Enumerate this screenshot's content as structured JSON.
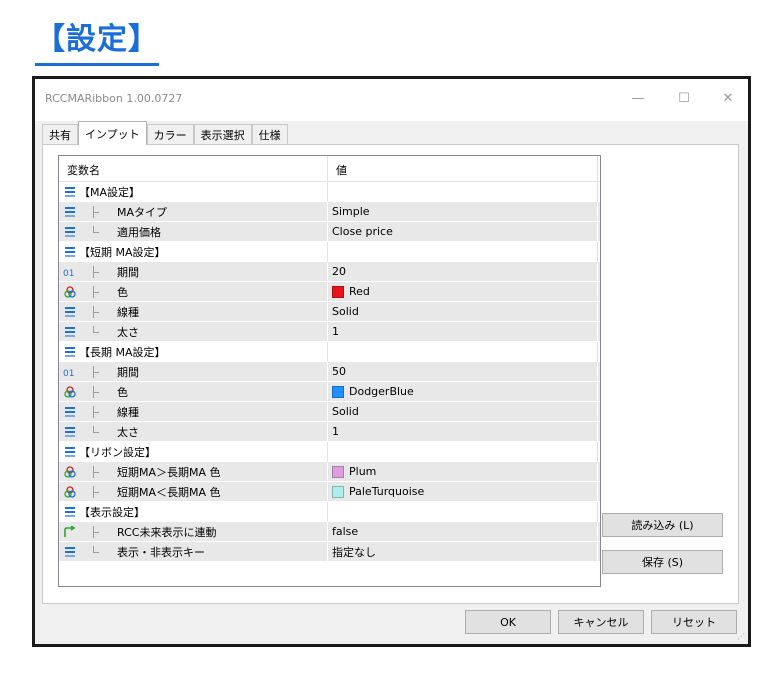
{
  "heading": "【設定】",
  "window": {
    "title": "RCCMARibbon 1.00.0727",
    "minimize_glyph": "—",
    "maximize_glyph": "☐",
    "close_glyph": "✕"
  },
  "tabs": [
    {
      "label": "共有"
    },
    {
      "label": "インプット"
    },
    {
      "label": "カラー"
    },
    {
      "label": "表示選択"
    },
    {
      "label": "仕様"
    }
  ],
  "grid": {
    "col_name": "変数名",
    "col_value": "値",
    "rows": [
      {
        "type": "group",
        "icon": "list-icon",
        "name": "【MA設定】",
        "value": ""
      },
      {
        "type": "item",
        "icon": "list-icon",
        "tree": "mid",
        "name": "MAタイプ",
        "value": "Simple"
      },
      {
        "type": "item",
        "icon": "list-icon",
        "tree": "end",
        "name": "適用価格",
        "value": "Close price"
      },
      {
        "type": "group",
        "icon": "list-icon",
        "name": "【短期 MA設定】",
        "value": ""
      },
      {
        "type": "item",
        "icon": "integer-icon",
        "tree": "mid",
        "name": "期間",
        "value": "20"
      },
      {
        "type": "item",
        "icon": "color-icon",
        "tree": "mid",
        "name": "色",
        "value": "Red",
        "swatch": "#e8141a"
      },
      {
        "type": "item",
        "icon": "list-icon",
        "tree": "mid",
        "name": "線種",
        "value": "Solid"
      },
      {
        "type": "item",
        "icon": "list-icon",
        "tree": "end",
        "name": "太さ",
        "value": "1"
      },
      {
        "type": "group",
        "icon": "list-icon",
        "name": "【長期 MA設定】",
        "value": ""
      },
      {
        "type": "item",
        "icon": "integer-icon",
        "tree": "mid",
        "name": "期間",
        "value": "50"
      },
      {
        "type": "item",
        "icon": "color-icon",
        "tree": "mid",
        "name": "色",
        "value": "DodgerBlue",
        "swatch": "#1e90ff"
      },
      {
        "type": "item",
        "icon": "list-icon",
        "tree": "mid",
        "name": "線種",
        "value": "Solid"
      },
      {
        "type": "item",
        "icon": "list-icon",
        "tree": "end",
        "name": "太さ",
        "value": "1"
      },
      {
        "type": "group",
        "icon": "list-icon",
        "name": "【リボン設定】",
        "value": ""
      },
      {
        "type": "item",
        "icon": "color-icon",
        "tree": "mid",
        "name": "短期MA＞長期MA 色",
        "value": "Plum",
        "swatch": "#dda0dd"
      },
      {
        "type": "item",
        "icon": "color-icon",
        "tree": "mid",
        "name": "短期MA＜長期MA 色",
        "value": "PaleTurquoise",
        "swatch": "#afeeee"
      },
      {
        "type": "group",
        "icon": "list-icon",
        "name": "【表示設定】",
        "value": ""
      },
      {
        "type": "item",
        "icon": "bool-icon",
        "tree": "mid",
        "name": "RCC未来表示に連動",
        "value": "false"
      },
      {
        "type": "item",
        "icon": "list-icon",
        "tree": "end",
        "name": "表示・非表示キー",
        "value": "指定なし"
      }
    ]
  },
  "side_buttons": {
    "load": "読み込み (L)",
    "save": "保存 (S)"
  },
  "footer_buttons": {
    "ok": "OK",
    "cancel": "キャンセル",
    "reset": "リセット"
  },
  "colors": {
    "heading": "#1a6ed8",
    "row_shade": "#e8e8e8",
    "list_icon": "#1e6fd9",
    "integer_icon": "#1e6fd9",
    "bool_icon": "#2aa52a"
  }
}
